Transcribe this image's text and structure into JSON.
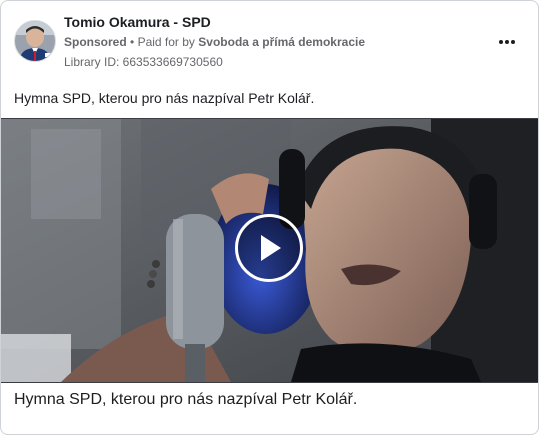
{
  "post": {
    "page_name": "Tomio Okamura - SPD",
    "sponsored_label": "Sponsored",
    "separator": "•",
    "paid_for_by_label": "Paid for by",
    "sponsor_name": "Svoboda a přímá demokracie",
    "library_id": "Library ID: 663533669730560",
    "ad_text": "Hymna SPD, kterou pro nás nazpíval Petr Kolář."
  },
  "video": {
    "play_icon": "play-icon",
    "caption": "Hymna SPD, kterou pro nás nazpíval Petr Kolář."
  },
  "icons": {
    "more_options": "more-options-icon",
    "avatar": "avatar"
  },
  "colors": {
    "text_primary": "#1c1e21",
    "text_secondary": "#65676b",
    "border": "#cfd2d6",
    "play_accent": "#ffffff"
  }
}
